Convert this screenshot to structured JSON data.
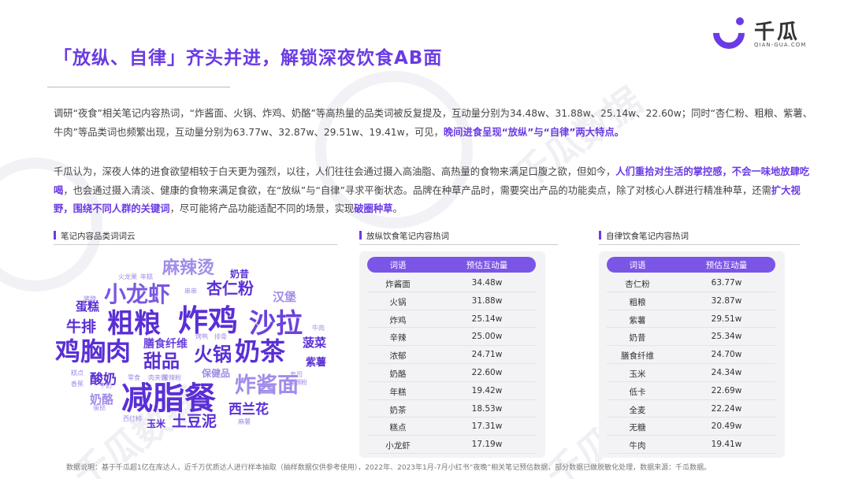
{
  "title": "「放纵、自律」齐头并进，解锁深夜饮食AB面",
  "logo": {
    "name": "千瓜",
    "sub": "QIAN-GUA.COM",
    "watermark": "千瓜数据"
  },
  "intro": {
    "p1_a": "调研“夜食”相关笔记内容热词，“炸酱面、火锅、炸鸡、奶酪”等高热量的品类词被反复提及，互动量分别为34.48w、31.88w、25.14w、22.60w；同时“杏仁粉、粗粮、紫薯、牛肉”等品类词也频繁出现，互动量分别为63.77w、32.87w、29.51w、19.41w，可见，",
    "p1_hl": "晚间进食呈现“放纵”与“自律”两大特点。",
    "p2_a": "千瓜认为，深夜人体的进食欲望相较于白天更为强烈，以往，人们往往会通过摄入高油脂、高热量的食物来满足口腹之欲，但如今，",
    "p2_hl1": "人们重拾对生活的掌控感，不会一味地放肆吃喝",
    "p2_b": "，也会通过摄入清淡、健康的食物来满足食欲，在“放纵”与“自律”寻求平衡状态。品牌在种草产品时，需要突出产品的功能卖点，除了对核心人群进行精准种草，还需",
    "p2_hl2": "扩大视野，围绕不同人群的关键词",
    "p2_c": "，尽可能将产品功能适配不同的场景，实现",
    "p2_hl3": "破圈种草",
    "p2_d": "。"
  },
  "cloud": {
    "title": "笔记内容品类词词云",
    "words": [
      {
        "text": "减脂餐",
        "size": 40,
        "color": "#5a2fd6"
      },
      {
        "text": "炸鸡",
        "size": 38,
        "color": "#5a2fd6"
      },
      {
        "text": "沙拉",
        "size": 34,
        "color": "#6b42de"
      },
      {
        "text": "粗粮",
        "size": 34,
        "color": "#5a2fd6"
      },
      {
        "text": "鸡胸肉",
        "size": 32,
        "color": "#5a2fd6"
      },
      {
        "text": "奶茶",
        "size": 32,
        "color": "#5a2fd6"
      },
      {
        "text": "小龙虾",
        "size": 28,
        "color": "#7a56e2"
      },
      {
        "text": "炸酱面",
        "size": 27,
        "color": "#a18cea"
      },
      {
        "text": "火锅",
        "size": 24,
        "color": "#5a2fd6"
      },
      {
        "text": "甜品",
        "size": 23,
        "color": "#5a2fd6"
      },
      {
        "text": "麻辣烫",
        "size": 22,
        "color": "#a18cea"
      },
      {
        "text": "杏仁粉",
        "size": 20,
        "color": "#5a2fd6"
      },
      {
        "text": "牛排",
        "size": 19,
        "color": "#5a2fd6"
      },
      {
        "text": "土豆泥",
        "size": 19,
        "color": "#5a2fd6"
      },
      {
        "text": "酸奶",
        "size": 17,
        "color": "#5a2fd6"
      },
      {
        "text": "西兰花",
        "size": 17,
        "color": "#5a2fd6"
      },
      {
        "text": "膳食纤维",
        "size": 14,
        "color": "#6b42de"
      },
      {
        "text": "汉堡",
        "size": 15,
        "color": "#a18cea"
      },
      {
        "text": "蛋糕",
        "size": 15,
        "color": "#5a2fd6"
      },
      {
        "text": "奶酪",
        "size": 15,
        "color": "#a18cea"
      },
      {
        "text": "菠菜",
        "size": 15,
        "color": "#5a2fd6"
      },
      {
        "text": "紫薯",
        "size": 13,
        "color": "#5a2fd6"
      },
      {
        "text": "保健品",
        "size": 12,
        "color": "#a18cea"
      },
      {
        "text": "奶昔",
        "size": 12,
        "color": "#5a2fd6"
      },
      {
        "text": "玉米",
        "size": 12,
        "color": "#5a2fd6"
      },
      {
        "text": "火龙果",
        "size": 8,
        "color": "#a18cea"
      },
      {
        "text": "年糕",
        "size": 8,
        "color": "#a18cea"
      },
      {
        "text": "猪蹄",
        "size": 8,
        "color": "#a18cea"
      },
      {
        "text": "串串",
        "size": 8,
        "color": "#a18cea"
      },
      {
        "text": "烤鸭",
        "size": 8,
        "color": "#a18cea"
      },
      {
        "text": "排骨",
        "size": 8,
        "color": "#a18cea"
      },
      {
        "text": "牛肉",
        "size": 8,
        "color": "#a18cea"
      },
      {
        "text": "糕点",
        "size": 8,
        "color": "#a18cea"
      },
      {
        "text": "零食",
        "size": 8,
        "color": "#a18cea"
      },
      {
        "text": "香蕉",
        "size": 8,
        "color": "#a18cea"
      },
      {
        "text": "牛奶",
        "size": 8,
        "color": "#a18cea"
      },
      {
        "text": "西红柿",
        "size": 8,
        "color": "#a18cea"
      },
      {
        "text": "蛋挞",
        "size": 8,
        "color": "#a18cea"
      },
      {
        "text": "肉夹馍",
        "size": 8,
        "color": "#a18cea"
      },
      {
        "text": "麻薯",
        "size": 8,
        "color": "#a18cea"
      },
      {
        "text": "酸辣粉",
        "size": 8,
        "color": "#a18cea"
      },
      {
        "text": "寿司",
        "size": 8,
        "color": "#a18cea"
      },
      {
        "text": "螺蛳粉",
        "size": 8,
        "color": "#a18cea"
      }
    ]
  },
  "indulge": {
    "title": "放纵饮食笔记内容热词",
    "col_word": "词语",
    "col_value": "预估互动量",
    "rows": [
      {
        "word": "炸酱面",
        "value": "34.48w"
      },
      {
        "word": "火锅",
        "value": "31.88w"
      },
      {
        "word": "炸鸡",
        "value": "25.14w"
      },
      {
        "word": "辛辣",
        "value": "25.00w"
      },
      {
        "word": "浓郁",
        "value": "24.71w"
      },
      {
        "word": "奶酪",
        "value": "22.60w"
      },
      {
        "word": "年糕",
        "value": "19.42w"
      },
      {
        "word": "奶茶",
        "value": "18.53w"
      },
      {
        "word": "糕点",
        "value": "17.31w"
      },
      {
        "word": "小龙虾",
        "value": "17.19w"
      }
    ]
  },
  "discipline": {
    "title": "自律饮食笔记内容热词",
    "col_word": "词语",
    "col_value": "预估互动量",
    "rows": [
      {
        "word": "杏仁粉",
        "value": "63.77w"
      },
      {
        "word": "粗粮",
        "value": "32.87w"
      },
      {
        "word": "紫薯",
        "value": "29.51w"
      },
      {
        "word": "奶昔",
        "value": "25.34w"
      },
      {
        "word": "膳食纤维",
        "value": "24.70w"
      },
      {
        "word": "玉米",
        "value": "24.34w"
      },
      {
        "word": "低卡",
        "value": "22.69w"
      },
      {
        "word": "全麦",
        "value": "22.24w"
      },
      {
        "word": "无糖",
        "value": "20.49w"
      },
      {
        "word": "牛肉",
        "value": "19.41w"
      }
    ]
  },
  "footnote": "数据说明：基于千瓜超1亿在库达人，近千万优质达人进行样本抽取（抽样数据仅供参考使用），2022年、2023年1月-7月小红书“夜晚”相关笔记预估数据，部分数据已做脱敏化处理，数据来源：千瓜数据。"
}
